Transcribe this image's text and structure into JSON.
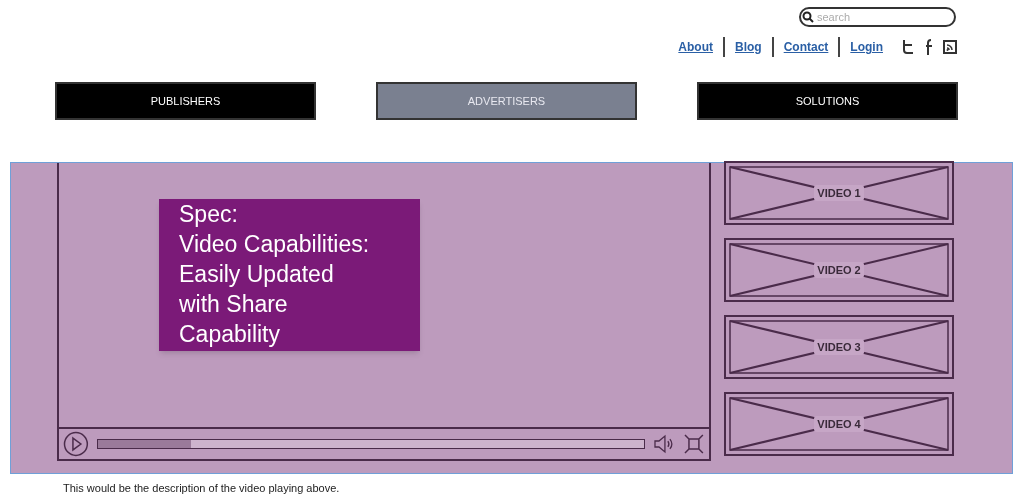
{
  "search": {
    "placeholder": "search"
  },
  "links": [
    "About",
    "Blog",
    "Contact",
    "Login"
  ],
  "nav": [
    {
      "label": "PUBLISHERS",
      "selected": false
    },
    {
      "label": "ADVERTISERS",
      "selected": true
    },
    {
      "label": "SOLUTIONS",
      "selected": false
    }
  ],
  "player": {
    "progress": {
      "level": 0.17
    }
  },
  "videos": [
    "VIDEO 1",
    "VIDEO 2",
    "VIDEO 3",
    "VIDEO 4"
  ],
  "spec_note": "Spec:\nVideo Capabilities:\nEasily Updated\nwith Share\nCapability",
  "description": "This would be the description of the video playing above."
}
